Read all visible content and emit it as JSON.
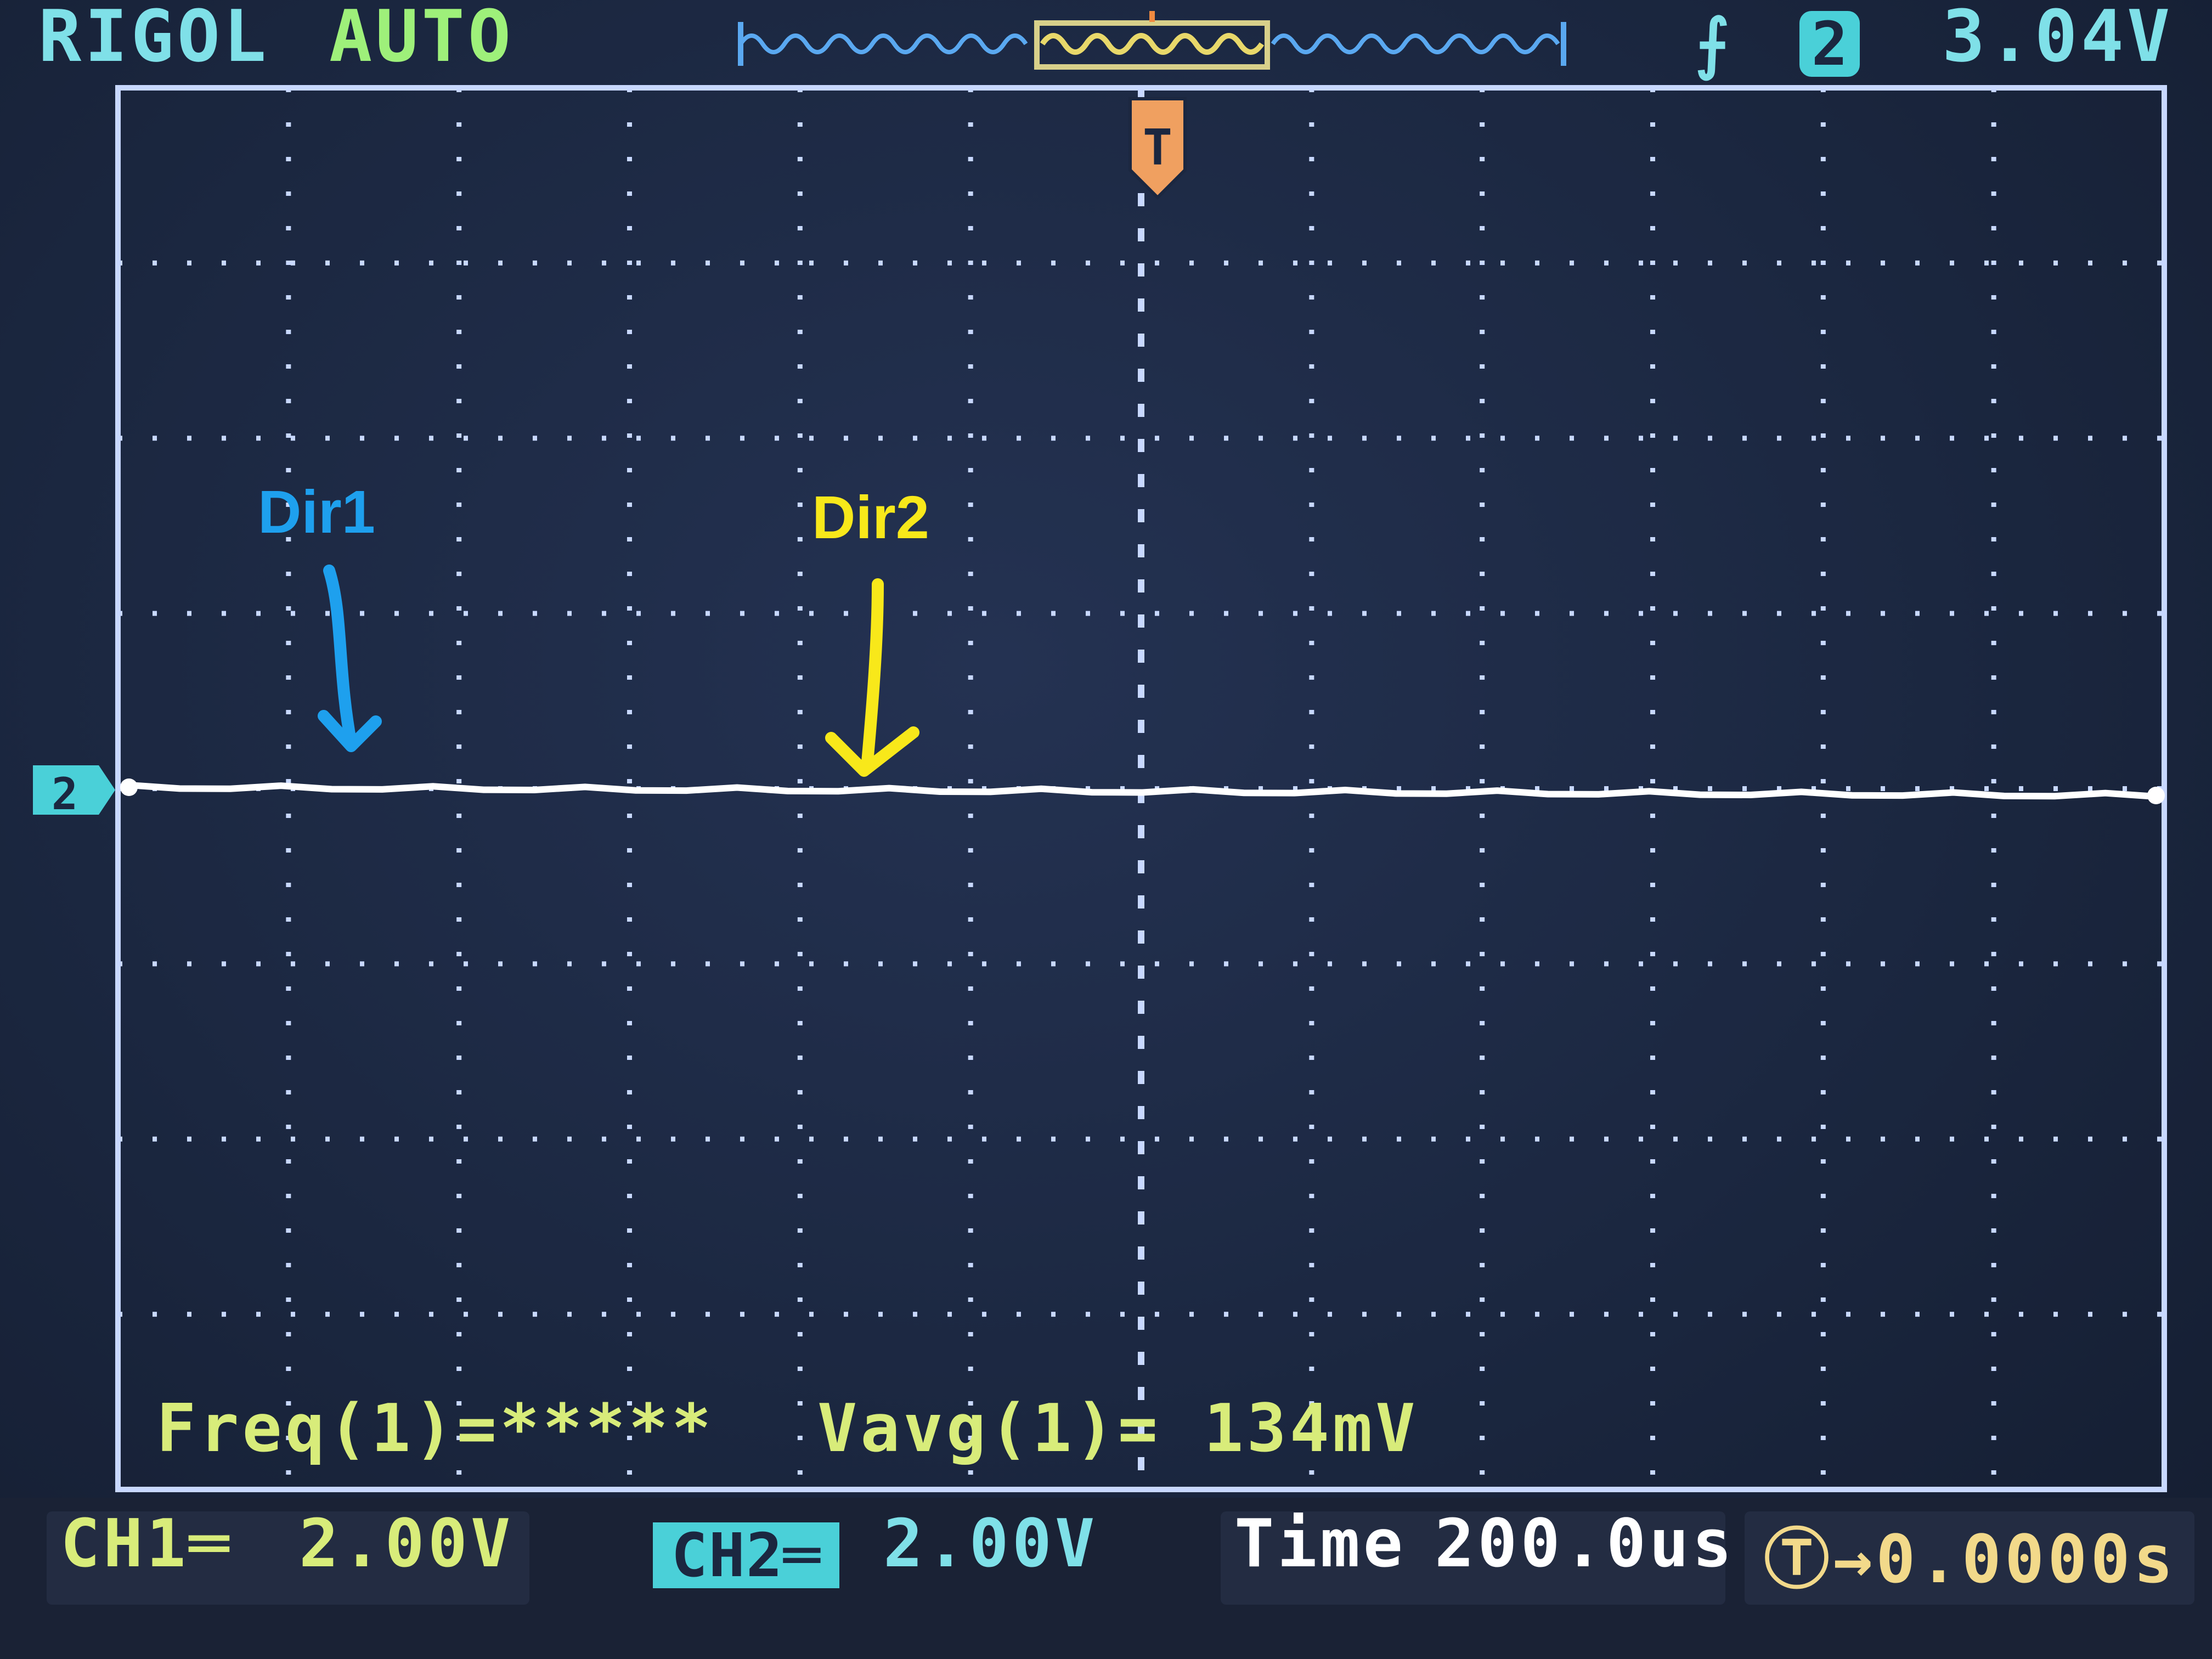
{
  "header": {
    "brand": "RIGOL",
    "mode": "AUTO",
    "trigger_source": "2",
    "trigger_level": "3.04V",
    "trigger_edge_icon": "rising-edge-icon"
  },
  "annotations": {
    "dir1": "Dir1",
    "dir2": "Dir2",
    "dir1_color": "#1ea0ee",
    "dir2_color": "#f8e81a"
  },
  "measurements": {
    "freq": "Freq(1)=*****",
    "vavg": "Vavg(1)= 134mV"
  },
  "footer": {
    "ch1_label": "CH1═",
    "ch1_scale": "2.00V",
    "ch2_label": "CH2═",
    "ch2_scale": "2.00V",
    "time_label": "Time",
    "time_scale": "200.0us",
    "trigger_offset": "Ⓣ→0.0000s"
  },
  "colors": {
    "screen_bg": "#1b2740",
    "grid": "#c8d8ff",
    "trace": "#ffffff",
    "ch1": "#d8ec7a",
    "ch2": "#4ad0d8",
    "trigger_marker": "#f0a060"
  },
  "chart_data": {
    "type": "line",
    "series": [
      {
        "channel": "CH2",
        "values": [
          0.1,
          0.1,
          0.1,
          0.1,
          0.1,
          0.1,
          0.1,
          0.1,
          0.1,
          0.1,
          0.1,
          0.1
        ]
      }
    ],
    "x_divisions": 12,
    "y_divisions": 8,
    "grid": true
  }
}
